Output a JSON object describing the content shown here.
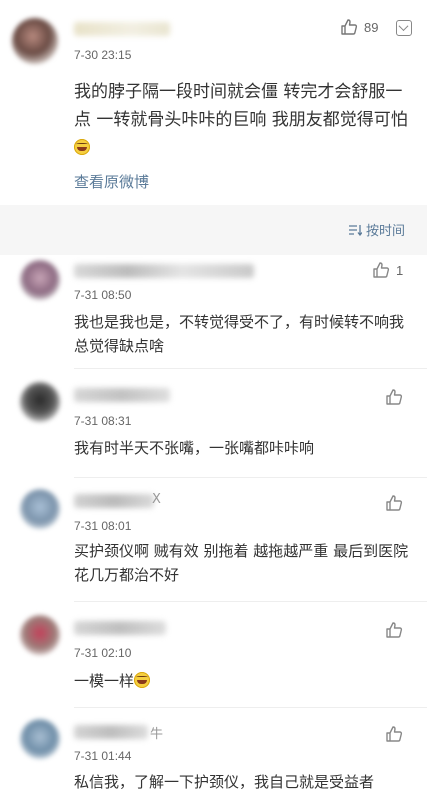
{
  "main_post": {
    "time": "7-30 23:15",
    "likes": "89",
    "text": "我的脖子隔一段时间就会僵  转完才会舒服一点  一转就骨头咔咔的巨响  我朋友都觉得可怕",
    "view_original": "查看原微博"
  },
  "sort_label": "按时间",
  "comments": [
    {
      "time": "7-31 08:50",
      "likes": "1",
      "text": "我也是我也是，不转觉得受不了，有时候转不响我总觉得缺点啥"
    },
    {
      "time": "7-31 08:31",
      "likes": "",
      "text": "我有时半天不张嘴，一张嘴都咔咔响"
    },
    {
      "time": "7-31 08:01",
      "likes": "",
      "name_suffix": "X",
      "text": "买护颈仪啊 贼有效 别拖着 越拖越严重 最后到医院花几万都治不好"
    },
    {
      "time": "7-31 02:10",
      "likes": "",
      "text": "一模一样"
    },
    {
      "time": "7-31 01:44",
      "likes": "",
      "name_suffix": "牛",
      "text": "私信我，了解一下护颈仪，我自己就是受益者"
    }
  ],
  "colors": {
    "link": "#5b7b99",
    "band": "#f6f6f6"
  }
}
